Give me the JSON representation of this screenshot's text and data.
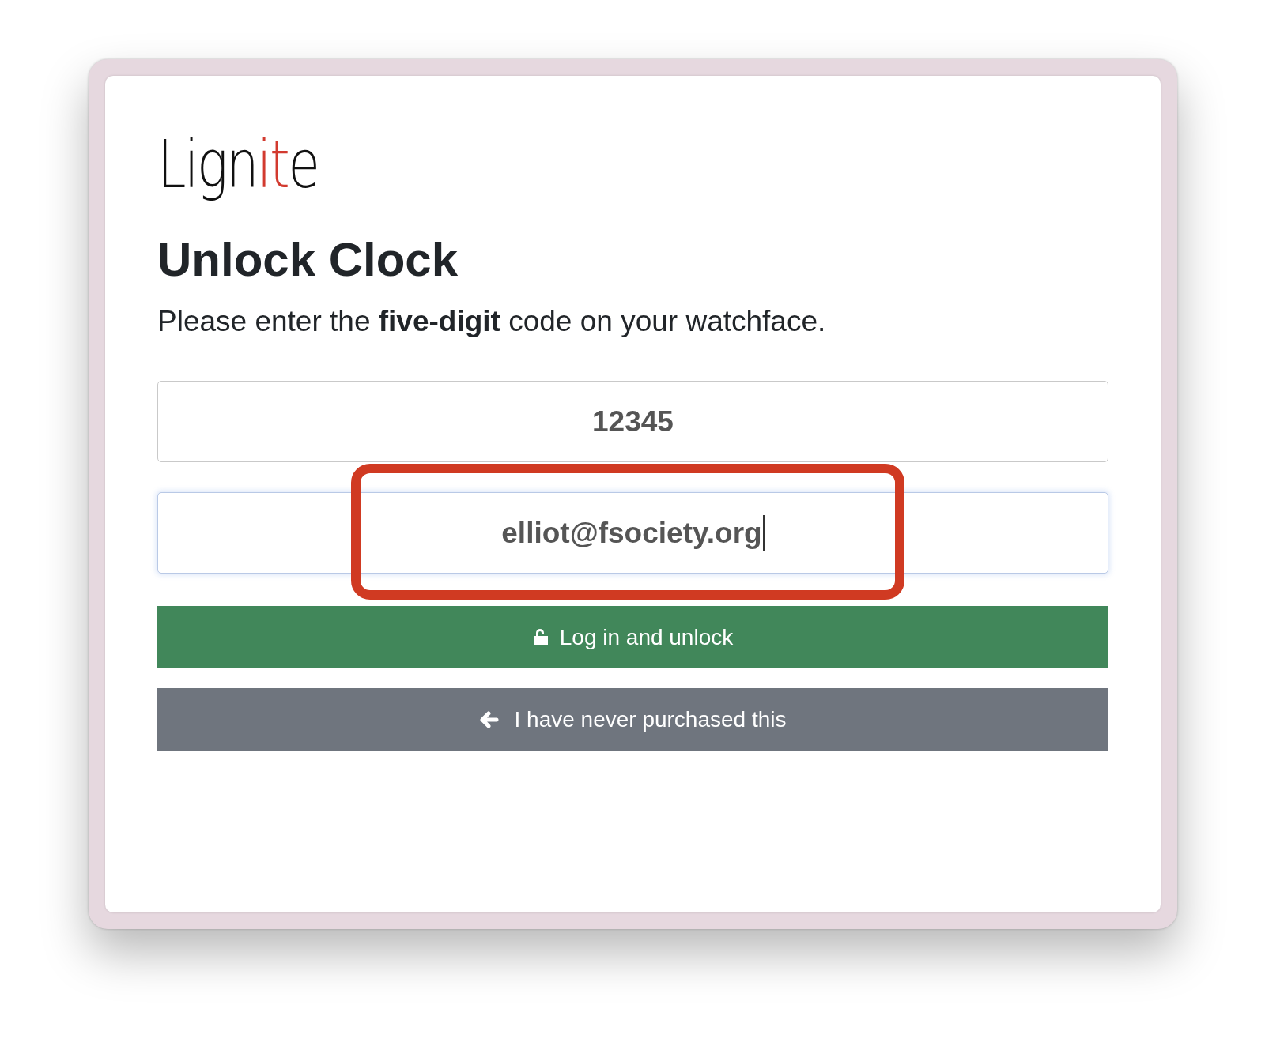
{
  "logo": [
    {
      "text": "Lign",
      "color": "#111111"
    },
    {
      "text": "it",
      "color": "#d23a2f"
    },
    {
      "text": "e",
      "color": "#111111"
    }
  ],
  "title": "Unlock Clock",
  "instruction": "Please enter the **five-digit** code on your watchface.",
  "fields": [
    {
      "value": "12345",
      "focused": false,
      "annotated": false
    },
    {
      "value": "elliot@fsociety.org",
      "focused": true,
      "annotated": true
    }
  ],
  "buttons": [
    {
      "label": "Log in and unlock",
      "kind": "primary"
    },
    {
      "label": "I have never purchased this",
      "kind": "secondary"
    }
  ]
}
